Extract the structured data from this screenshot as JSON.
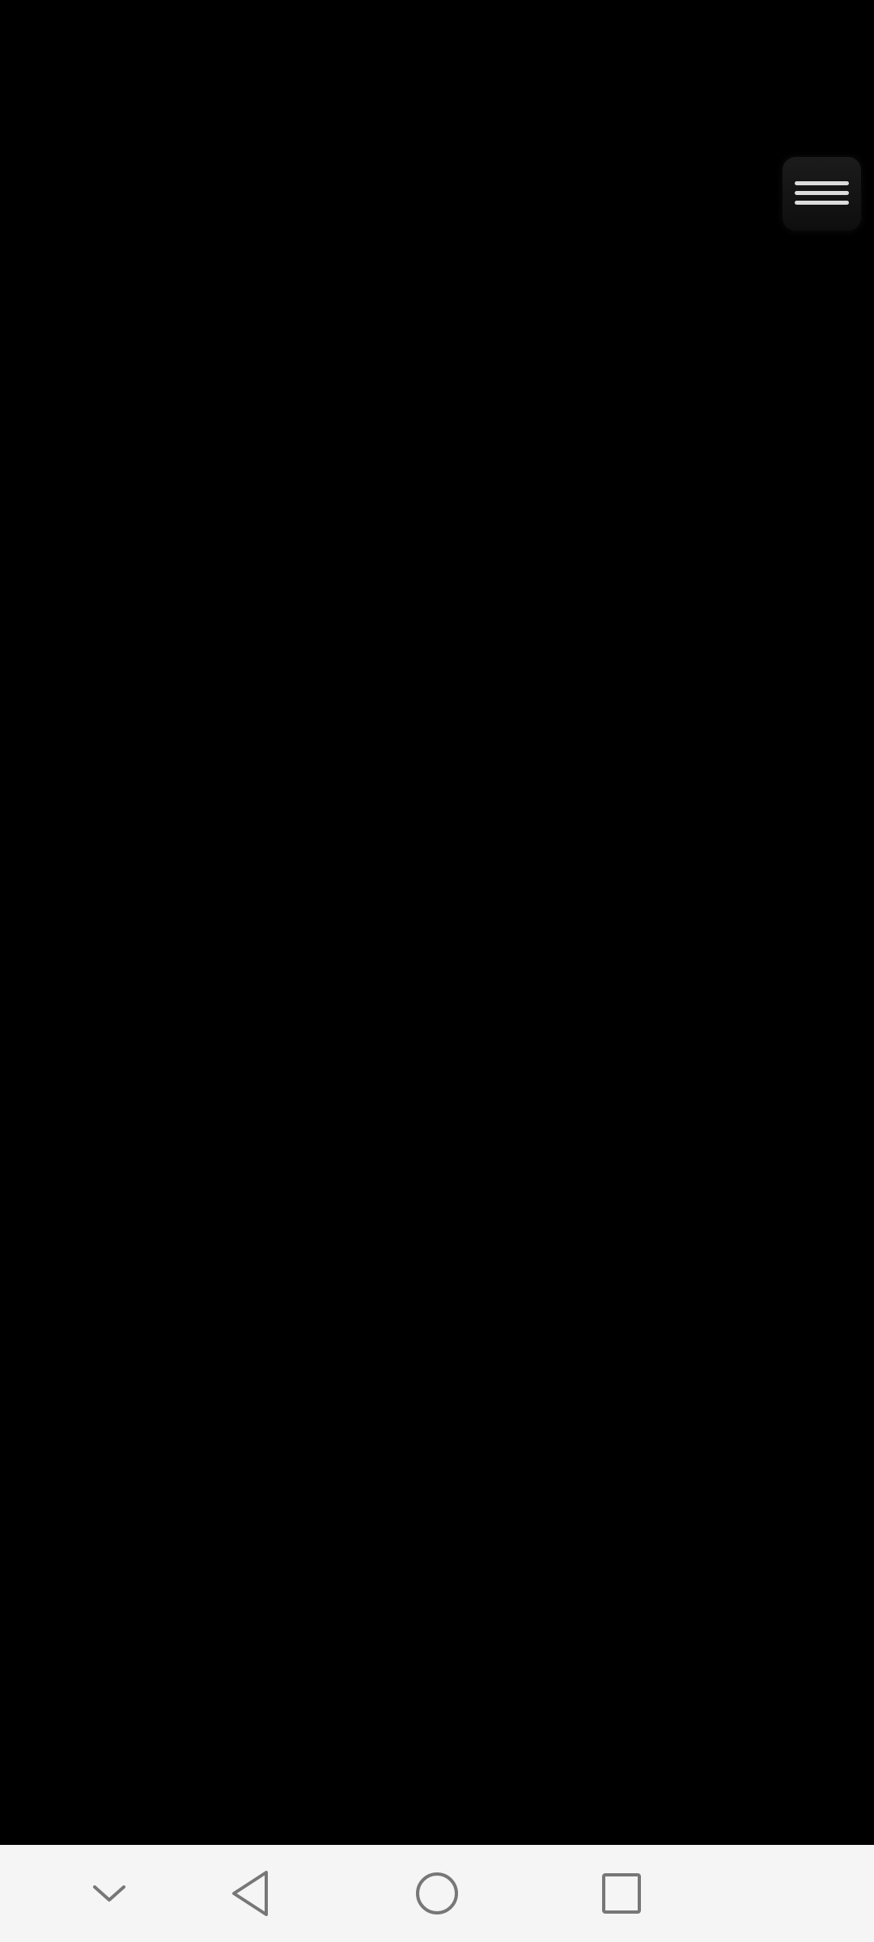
{
  "app": {
    "background_color": "#000000"
  },
  "menu_button": {
    "icon": "hamburger-menu-icon",
    "color": "#d9d9d9"
  },
  "nav_bar": {
    "background_color": "#f5f5f5",
    "icon_color": "#7a7a7a",
    "buttons": [
      {
        "icon": "chevron-down-icon"
      },
      {
        "icon": "back-triangle-icon"
      },
      {
        "icon": "home-circle-icon"
      },
      {
        "icon": "recents-square-icon"
      }
    ]
  }
}
